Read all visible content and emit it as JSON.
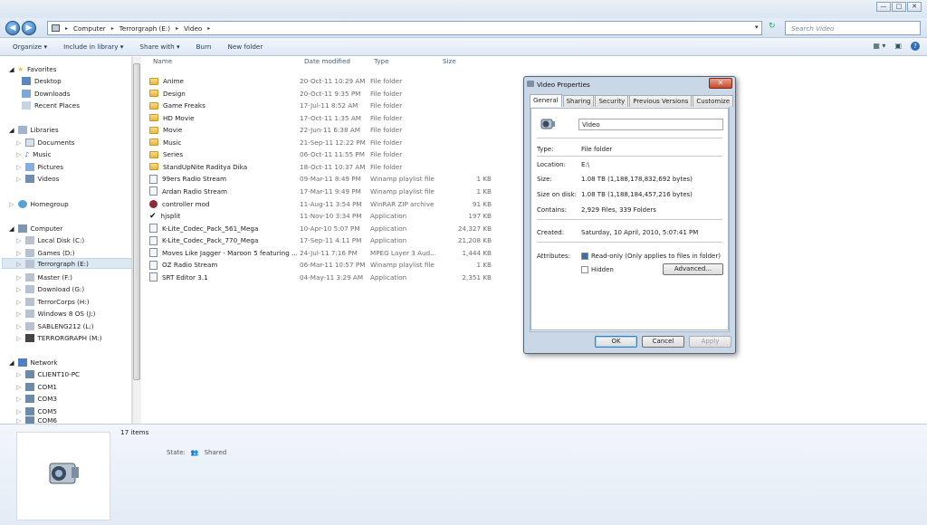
{
  "window": {
    "controls": [
      "—",
      "□",
      "✕"
    ]
  },
  "address": {
    "segments": [
      "Computer",
      "Terrorgraph (E:)",
      "Video"
    ]
  },
  "search": {
    "placeholder": "Search Video"
  },
  "commands": [
    "Organize ▾",
    "Include in library ▾",
    "Share with ▾",
    "Burn",
    "New folder"
  ],
  "nav": {
    "favorites": {
      "title": "Favorites",
      "items": [
        "Desktop",
        "Downloads",
        "Recent Places"
      ]
    },
    "libraries": {
      "title": "Libraries",
      "items": [
        "Documents",
        "Music",
        "Pictures",
        "Videos"
      ]
    },
    "homegroup": "Homegroup",
    "computer": {
      "title": "Computer",
      "items": [
        "Local Disk (C:)",
        "Games (D:)",
        "Terrorgraph (E:)",
        "Master (F:)",
        "Download (G:)",
        "TerrorCorps (H:)",
        "Windows 8 OS (J:)",
        "SABLENG212 (L:)",
        "TERRORGRAPH (M:)"
      ]
    },
    "network": {
      "title": "Network",
      "items": [
        "CLIENT10-PC",
        "COM1",
        "COM3",
        "COM5",
        "COM6"
      ]
    }
  },
  "columns": {
    "name": "Name",
    "date": "Date modified",
    "type": "Type",
    "size": "Size"
  },
  "files": [
    {
      "name": "Anime",
      "date": "20-Oct-11 10:29 AM",
      "type": "File folder",
      "size": "",
      "icon": "folder"
    },
    {
      "name": "Design",
      "date": "20-Oct-11 9:35 PM",
      "type": "File folder",
      "size": "",
      "icon": "folder"
    },
    {
      "name": "Game Freaks",
      "date": "17-Jul-11 8:52 AM",
      "type": "File folder",
      "size": "",
      "icon": "folder"
    },
    {
      "name": "HD Movie",
      "date": "17-Oct-11 1:35 AM",
      "type": "File folder",
      "size": "",
      "icon": "folder"
    },
    {
      "name": "Movie",
      "date": "22-Jun-11 6:38 AM",
      "type": "File folder",
      "size": "",
      "icon": "folder"
    },
    {
      "name": "Music",
      "date": "21-Sep-11 12:22 PM",
      "type": "File folder",
      "size": "",
      "icon": "folder"
    },
    {
      "name": "Series",
      "date": "06-Oct-11 11:55 PM",
      "type": "File folder",
      "size": "",
      "icon": "folder"
    },
    {
      "name": "StandUpNite Raditya Dika",
      "date": "18-Oct-11 10:37 AM",
      "type": "File folder",
      "size": "",
      "icon": "folder"
    },
    {
      "name": "99ers Radio Stream",
      "date": "09-Mar-11 8:49 PM",
      "type": "Winamp playlist file",
      "size": "1 KB",
      "icon": "file"
    },
    {
      "name": "Ardan Radio Stream",
      "date": "17-Mar-11 9:49 PM",
      "type": "Winamp playlist file",
      "size": "1 KB",
      "icon": "file"
    },
    {
      "name": "controller mod",
      "date": "11-Aug-11 3:54 PM",
      "type": "WinRAR ZIP archive",
      "size": "91 KB",
      "icon": "zip"
    },
    {
      "name": "hjsplit",
      "date": "11-Nov-10 3:34 PM",
      "type": "Application",
      "size": "197 KB",
      "icon": "check"
    },
    {
      "name": "K-Lite_Codec_Pack_561_Mega",
      "date": "10-Apr-10 5:07 PM",
      "type": "Application",
      "size": "24,327 KB",
      "icon": "file"
    },
    {
      "name": "K-Lite_Codec_Pack_770_Mega",
      "date": "17-Sep-11 4:11 PM",
      "type": "Application",
      "size": "21,208 KB",
      "icon": "file"
    },
    {
      "name": "Moves Like Jagger - Maroon 5 featuring ...",
      "date": "24-Jul-11 7:16 PM",
      "type": "MPEG Layer 3 Aud...",
      "size": "1,444 KB",
      "icon": "file"
    },
    {
      "name": "OZ Radio Stream",
      "date": "06-Mar-11 10:57 PM",
      "type": "Winamp playlist file",
      "size": "1 KB",
      "icon": "file"
    },
    {
      "name": "SRT Editor 3.1",
      "date": "04-May-11 3:29 AM",
      "type": "Application",
      "size": "2,351 KB",
      "icon": "file"
    }
  ],
  "details": {
    "count": "17 items",
    "state_label": "State:",
    "state_value": "Shared"
  },
  "dialog": {
    "title": "Video Properties",
    "close": "✕",
    "tabs": [
      "General",
      "Sharing",
      "Security",
      "Previous Versions",
      "Customize"
    ],
    "name": "Video",
    "rows": [
      {
        "label": "Type:",
        "value": "File folder"
      },
      {
        "label": "Location:",
        "value": "E:\\"
      },
      {
        "label": "Size:",
        "value": "1.08 TB (1,188,178,832,692 bytes)"
      },
      {
        "label": "Size on disk:",
        "value": "1.08 TB (1,188,184,457,216 bytes)"
      },
      {
        "label": "Contains:",
        "value": "2,929 Files, 339 Folders"
      },
      {
        "label": "Created:",
        "value": "Saturday, 10 April, 2010, 5:07:41 PM"
      }
    ],
    "attributes_label": "Attributes:",
    "readonly": "Read-only (Only applies to files in folder)",
    "hidden": "Hidden",
    "advanced": "Advanced...",
    "ok": "OK",
    "cancel": "Cancel",
    "apply": "Apply"
  }
}
